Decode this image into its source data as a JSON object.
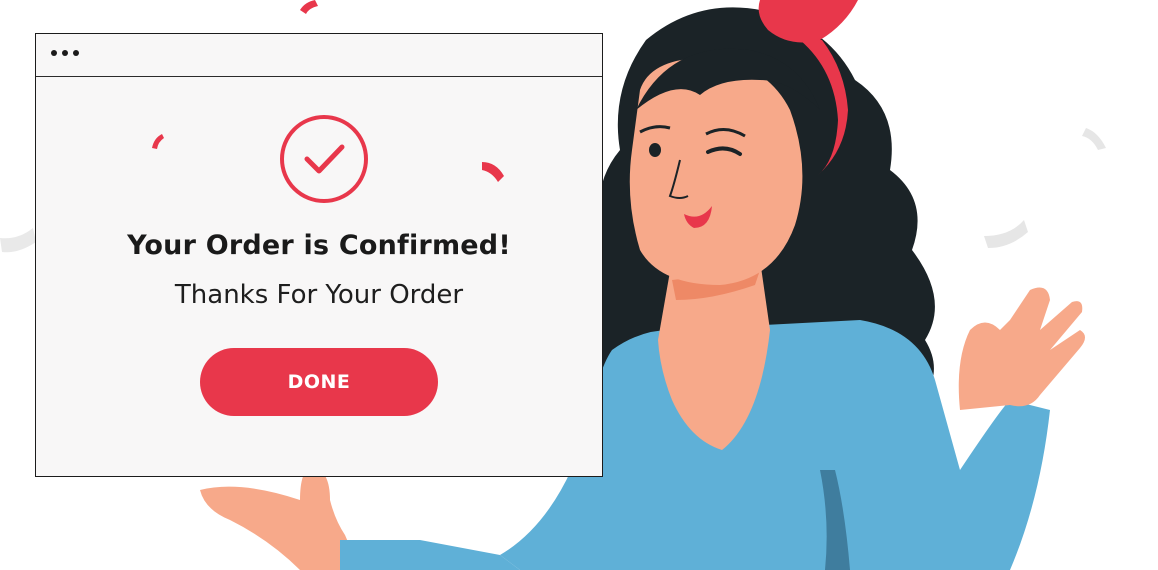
{
  "dialog": {
    "title": "Your Order is Confirmed!",
    "subtitle": "Thanks For Your Order",
    "done_label": "DONE",
    "status_icon": "checkmark-circle-icon",
    "menu_icon": "more-dots-icon"
  },
  "colors": {
    "accent": "#e8374b",
    "text": "#1a1a1a",
    "window_bg": "#f8f7f7",
    "shirt": "#5fb0d7",
    "hair": "#1b2327",
    "skin": "#f7a98a"
  }
}
